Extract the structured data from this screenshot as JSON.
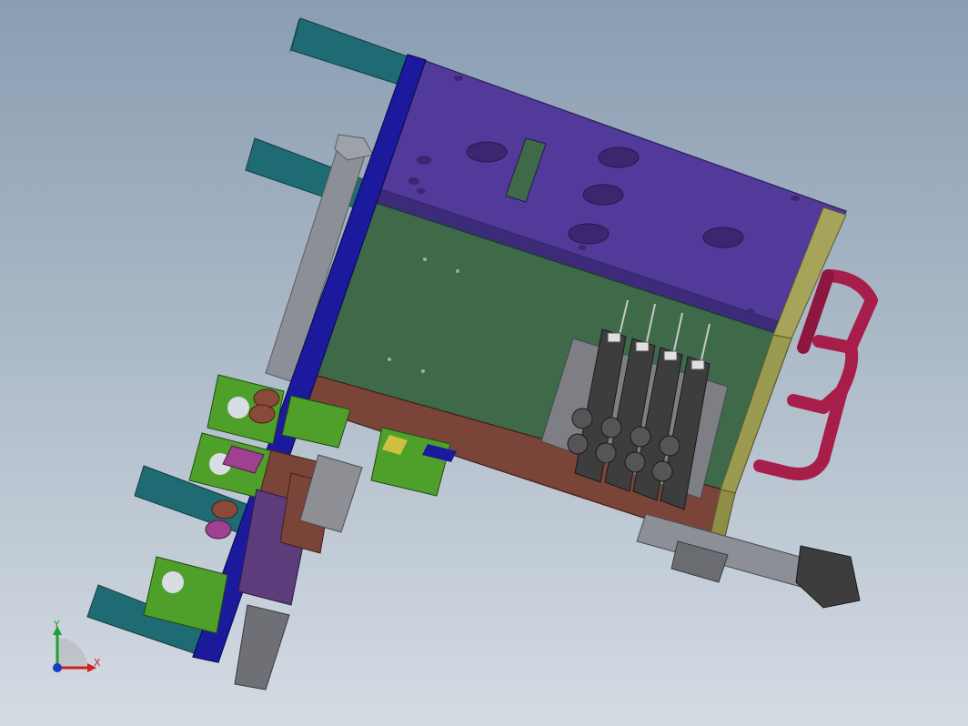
{
  "viewport": {
    "background_top": "#8a9db2",
    "background_bottom": "#d4dbe3"
  },
  "model": {
    "parts": [
      {
        "name": "top-plate",
        "color": "#523a9a"
      },
      {
        "name": "mid-plate",
        "color": "#3e6a4a"
      },
      {
        "name": "base-plate",
        "color": "#7a4538"
      },
      {
        "name": "side-plate",
        "color": "#1c1a9c"
      },
      {
        "name": "end-plate",
        "color": "#9a9a50"
      },
      {
        "name": "guide-rails",
        "color": "#1f6b73"
      },
      {
        "name": "air-hose",
        "color": "#a81e4a"
      },
      {
        "name": "valve-manifold",
        "color": "#3d3d3d"
      },
      {
        "name": "clamp-brackets",
        "color": "#4fa02a"
      },
      {
        "name": "cylinder",
        "color": "#7d7f85"
      }
    ]
  },
  "triad": {
    "x_label": "X",
    "y_label": "Y",
    "x_color": "#d02020",
    "y_color": "#20a030",
    "z_color": "#1a3cc0"
  }
}
